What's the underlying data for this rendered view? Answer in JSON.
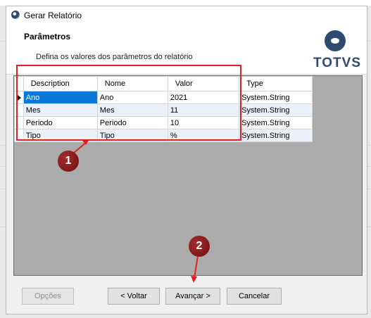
{
  "window": {
    "title": "Gerar Relatório"
  },
  "header": {
    "section_title": "Parâmetros",
    "description": "Defina os valores dos parâmetros do relatório",
    "logo_text": "TOTVS"
  },
  "grid": {
    "columns": [
      "Description",
      "Nome",
      "Valor",
      "Type"
    ],
    "rows": [
      [
        "Ano",
        "Ano",
        "2021",
        "System.String"
      ],
      [
        "Mes",
        "Mes",
        "11",
        "System.String"
      ],
      [
        "Periodo",
        "Periodo",
        "10",
        "System.String"
      ],
      [
        "Tipo",
        "Tipo",
        "%",
        "System.String"
      ]
    ]
  },
  "annotations": {
    "badge_1": "1",
    "badge_2": "2"
  },
  "buttons": {
    "options": "Opções",
    "back": "< Voltar",
    "next": "Avançar >",
    "cancel": "Cancelar"
  },
  "colors": {
    "selection": "#0a78d7",
    "annotation_red": "#e02020",
    "badge": "#8b1a1a",
    "logo": "#2e4a6e"
  }
}
